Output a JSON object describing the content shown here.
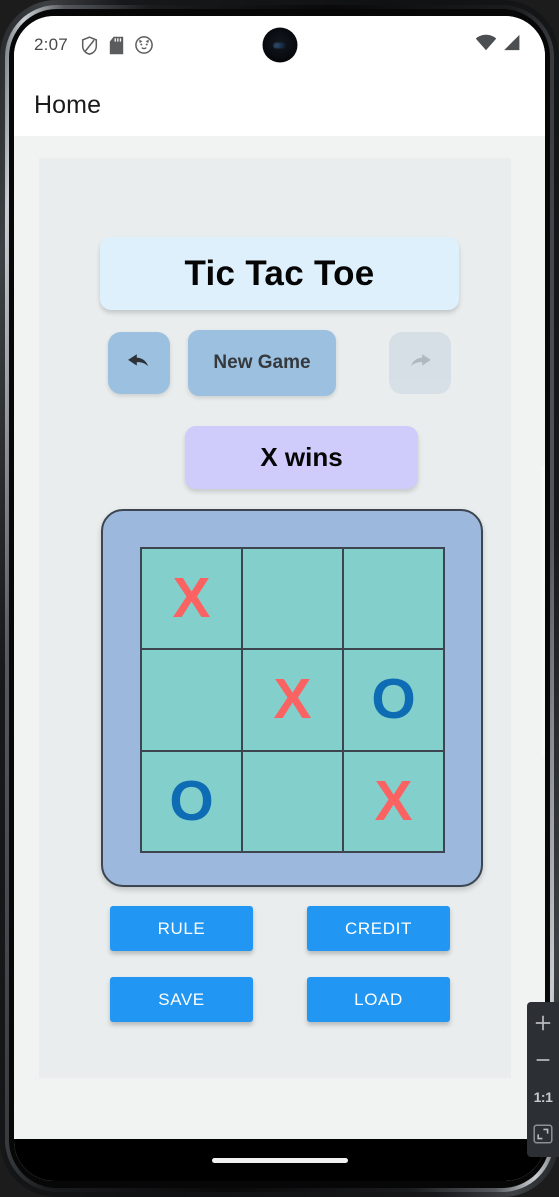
{
  "device": {
    "status_bar": {
      "clock": "2:07",
      "left_icons": [
        "shield-icon",
        "sd-card-icon",
        "cat-face-icon"
      ],
      "right_icons": [
        "wifi-icon",
        "cellular-signal-icon"
      ],
      "camera": "front-camera-punch-hole"
    },
    "nav_bar": {
      "gesture_pill": "home-gesture-pill"
    }
  },
  "app_bar": {
    "title": "Home"
  },
  "game": {
    "title": "Tic Tac Toe",
    "controls": {
      "undo_icon": "undo-arrow-icon",
      "new_game_label": "New Game",
      "redo_icon": "redo-arrow-icon",
      "redo_disabled": true
    },
    "status_message": "X wins",
    "board": {
      "cells": [
        "X",
        "",
        "",
        "",
        "X",
        "O",
        "O",
        "",
        "X"
      ],
      "rows": 3,
      "cols": 3
    },
    "actions": [
      {
        "label": "RULE"
      },
      {
        "label": "CREDIT"
      },
      {
        "label": "SAVE"
      },
      {
        "label": "LOAD"
      }
    ]
  },
  "zoom_toolbar": {
    "zoom_in": "+",
    "zoom_out": "−",
    "actual_size": "1:1",
    "fit_icon": "fit-to-screen-icon"
  },
  "colors": {
    "title_card_bg": "#def0fc",
    "control_bg": "#9cc0e0",
    "status_banner_bg": "#cfcbfa",
    "board_frame": "#9cb8dc",
    "cell_bg": "#83cfcb",
    "mark_x": "#fb6262",
    "mark_o": "#0d6cb3",
    "action_button": "#2196f3",
    "page_bg": "#f1f2f2",
    "panel_bg": "#e9eded"
  }
}
